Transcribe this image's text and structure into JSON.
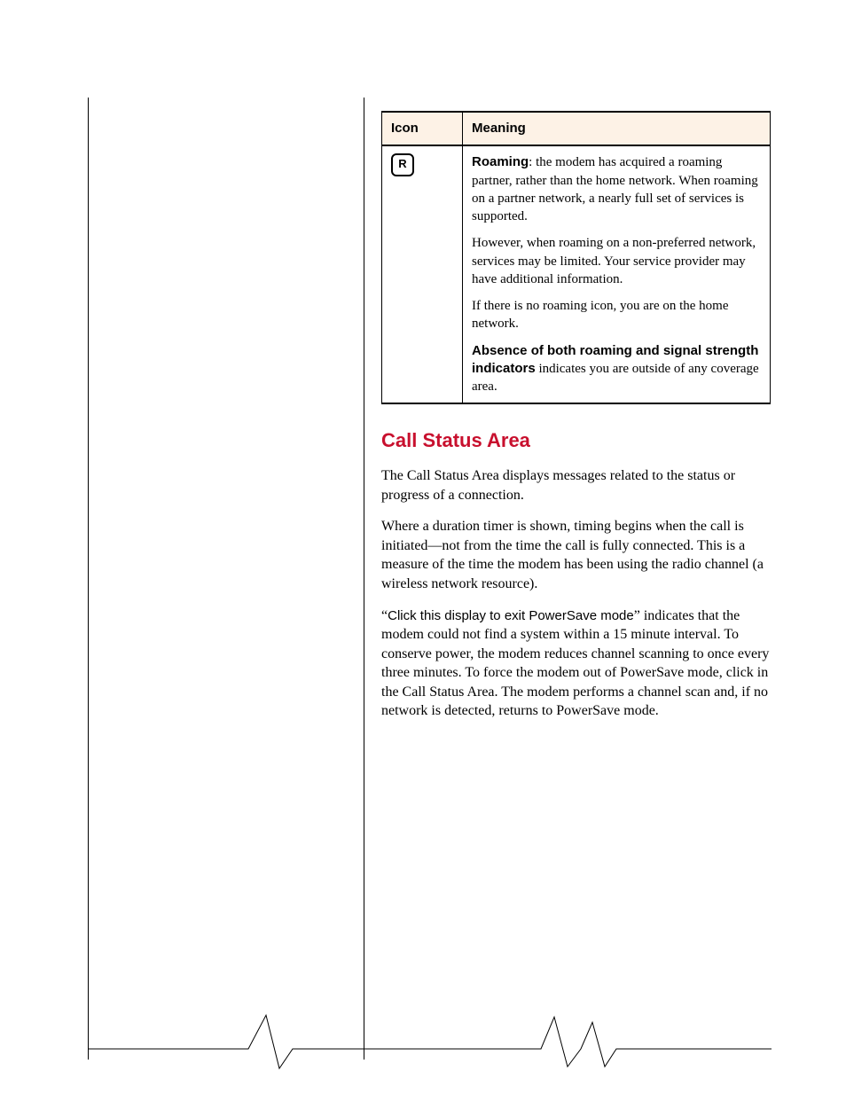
{
  "table": {
    "header_icon": "Icon",
    "header_meaning": "Meaning",
    "row": {
      "icon_letter": "R",
      "icon_name": "roaming-icon",
      "para1_prefix": "Roaming",
      "para1_rest": ": the modem has acquired a roaming partner, rather than the home network. When roaming on a partner network, a nearly full set of services is supported.",
      "para2": "However, when roaming on a non-preferred network, services may be limited. Your service provider may have additional information.",
      "para3": "If there is no roaming icon, you are on the home network.",
      "para4_prefix": "Absence of both roaming and signal strength indicators",
      "para4_rest": " indicates you are outside of any coverage area."
    }
  },
  "section_title": "Call Status Area",
  "p1": "The Call Status Area displays messages related to the status or progress of a connection.",
  "p2": "Where a duration timer is shown, timing begins when the call is initiated—not from the time the call is fully connected. This is a measure of the time the modem has been using the radio channel (a wireless network resource).",
  "p3_quote": "Click this display to exit PowerSave mode",
  "p3_open": "“",
  "p3_close": "”",
  "p3_rest": " indicates that the modem could not find a system within a 15 minute interval. To conserve power, the modem reduces channel scanning to once every three minutes. To force the modem out of PowerSave mode, click in the Call Status Area. The modem performs a channel scan and, if no network is detected, returns to PowerSave mode."
}
